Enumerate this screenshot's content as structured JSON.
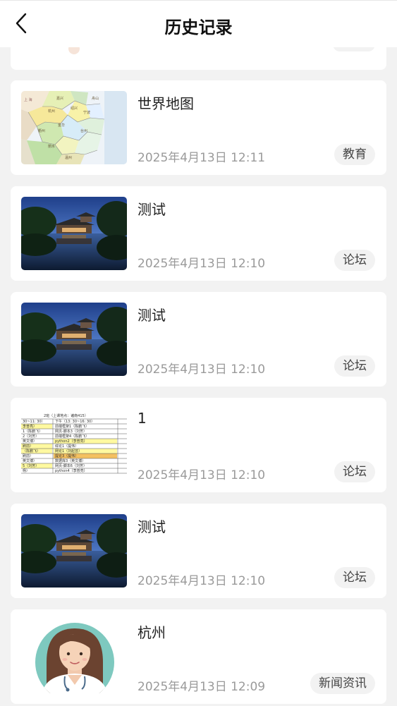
{
  "header": {
    "title": "历史记录"
  },
  "items": [
    {
      "title": "世界地图",
      "date": "2025年4月13日 12:11",
      "tag": "教育",
      "thumb": "map-thumbnail"
    },
    {
      "title": "测试",
      "date": "2025年4月13日 12:10",
      "tag": "论坛",
      "thumb": "garden-photo-thumbnail"
    },
    {
      "title": "测试",
      "date": "2025年4月13日 12:10",
      "tag": "论坛",
      "thumb": "garden-photo-thumbnail"
    },
    {
      "title": "1",
      "date": "2025年4月13日 12:10",
      "tag": "论坛",
      "thumb": "spreadsheet-thumbnail"
    },
    {
      "title": "测试",
      "date": "2025年4月13日 12:10",
      "tag": "论坛",
      "thumb": "garden-photo-thumbnail"
    },
    {
      "title": "杭州",
      "date": "2025年4月13日 12:09",
      "tag": "新闻资讯",
      "thumb": "doctor-avatar-thumbnail"
    }
  ],
  "icons": {
    "back": "chevron-left-icon"
  },
  "colors": {
    "background": "#f2f2f2",
    "card": "#ffffff",
    "tag_bg": "#f2f2f2",
    "date": "#9a9a9a"
  }
}
